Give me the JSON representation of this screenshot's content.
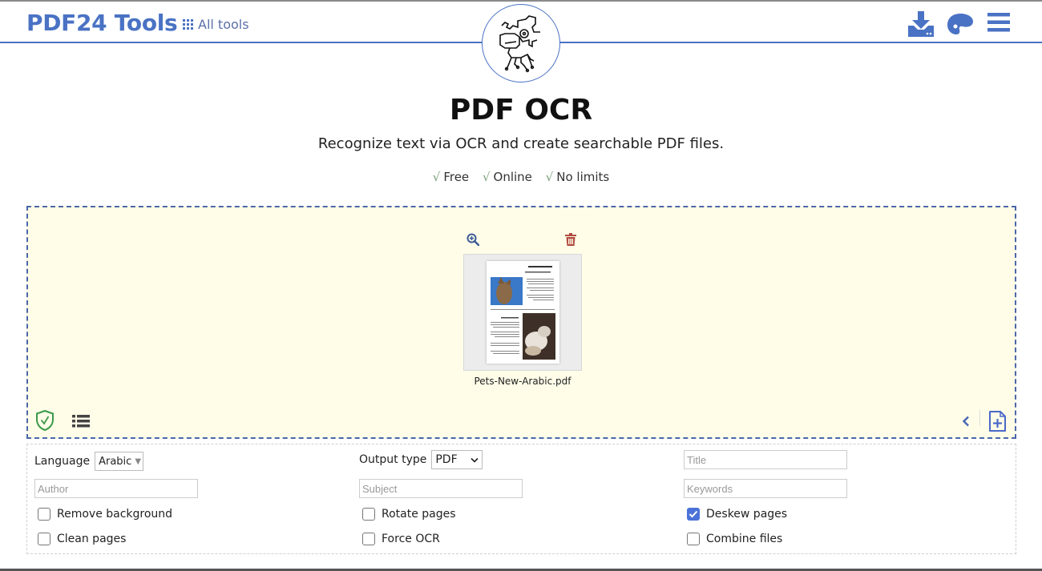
{
  "header": {
    "brand": "PDF24 Tools",
    "all_tools_label": "All tools",
    "icons": [
      "download-icon",
      "palette-icon",
      "menu-icon"
    ],
    "accent_color": "#4a72c4"
  },
  "hero": {
    "title": "PDF OCR",
    "subtitle": "Recognize text via OCR and create searchable PDF files.",
    "features": [
      {
        "check": "√",
        "label": "Free"
      },
      {
        "check": "√",
        "label": "Online"
      },
      {
        "check": "√",
        "label": "No limits"
      }
    ]
  },
  "dropzone": {
    "background": "#fffde8",
    "files": [
      {
        "name": "Pets-New-Arabic.pdf"
      }
    ]
  },
  "options": {
    "language": {
      "label": "Language",
      "value": "Arabic"
    },
    "output_type": {
      "label": "Output type",
      "value": "PDF"
    },
    "fields": {
      "title_placeholder": "Title",
      "author_placeholder": "Author",
      "subject_placeholder": "Subject",
      "keywords_placeholder": "Keywords"
    },
    "checkboxes": {
      "remove_background": {
        "label": "Remove background",
        "checked": false
      },
      "rotate_pages": {
        "label": "Rotate pages",
        "checked": false
      },
      "deskew_pages": {
        "label": "Deskew pages",
        "checked": true
      },
      "clean_pages": {
        "label": "Clean pages",
        "checked": false
      },
      "force_ocr": {
        "label": "Force OCR",
        "checked": false
      },
      "combine_files": {
        "label": "Combine files",
        "checked": false
      }
    }
  }
}
